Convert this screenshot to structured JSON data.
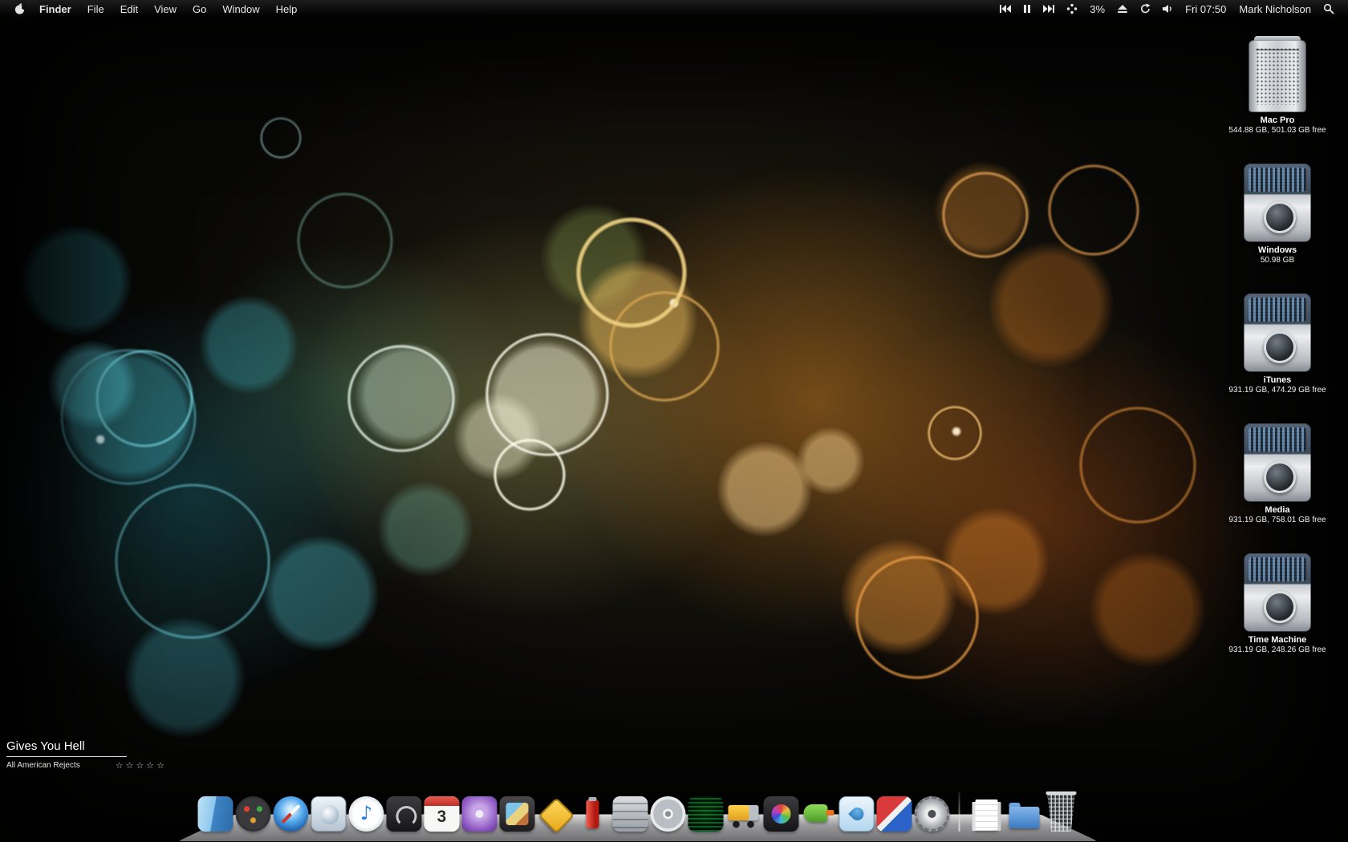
{
  "menu_bar": {
    "app_menu": "Finder",
    "menus": [
      {
        "label": "File"
      },
      {
        "label": "Edit"
      },
      {
        "label": "View"
      },
      {
        "label": "Go"
      },
      {
        "label": "Window"
      },
      {
        "label": "Help"
      }
    ],
    "status": {
      "percent": "3%",
      "clock": "Fri 07:50",
      "user": "Mark Nicholson"
    },
    "status_icons": [
      "rewind-icon",
      "pause-icon",
      "fast-forward-icon",
      "spinner-icon",
      "eject-icon",
      "sync-icon",
      "volume-icon",
      "spotlight-icon"
    ]
  },
  "desktop": {
    "icons": [
      {
        "name": "Mac Pro",
        "detail": "544.88 GB, 501.03 GB free",
        "kind": "computer"
      },
      {
        "name": "Windows",
        "detail": "50.98 GB",
        "kind": "drive"
      },
      {
        "name": "iTunes",
        "detail": "931.19 GB, 474.29 GB free",
        "kind": "drive"
      },
      {
        "name": "Media",
        "detail": "931.19 GB, 758.01 GB free",
        "kind": "drive"
      },
      {
        "name": "Time Machine",
        "detail": "931.19 GB, 248.26 GB free",
        "kind": "drive"
      }
    ]
  },
  "now_playing": {
    "title": "Gives You Hell",
    "artist": "All American Rejects",
    "rating": "☆☆☆☆☆"
  },
  "dock": {
    "items": [
      {
        "icon": "finder-icon"
      },
      {
        "icon": "dashboard-icon"
      },
      {
        "icon": "safari-icon"
      },
      {
        "icon": "mail-icon"
      },
      {
        "icon": "itunes-icon"
      },
      {
        "icon": "dark-app-icon"
      },
      {
        "icon": "ical-icon",
        "day": "3"
      },
      {
        "icon": "textmate-icon"
      },
      {
        "icon": "photo-app-icon"
      },
      {
        "icon": "roadsign-app-icon"
      },
      {
        "icon": "red-app-icon"
      },
      {
        "icon": "archive-app-icon"
      },
      {
        "icon": "disc-app-icon"
      },
      {
        "icon": "terminal-app-icon"
      },
      {
        "icon": "transmit-truck-icon"
      },
      {
        "icon": "paint-app-icon"
      },
      {
        "icon": "raygun-app-icon"
      },
      {
        "icon": "water-app-icon"
      },
      {
        "icon": "red-blue-app-icon"
      },
      {
        "icon": "system-preferences-icon"
      },
      {
        "icon": "dock-separator",
        "inter": "false"
      },
      {
        "icon": "documents-stack-icon"
      },
      {
        "icon": "downloads-folder-icon"
      },
      {
        "icon": "trash-icon"
      }
    ]
  }
}
